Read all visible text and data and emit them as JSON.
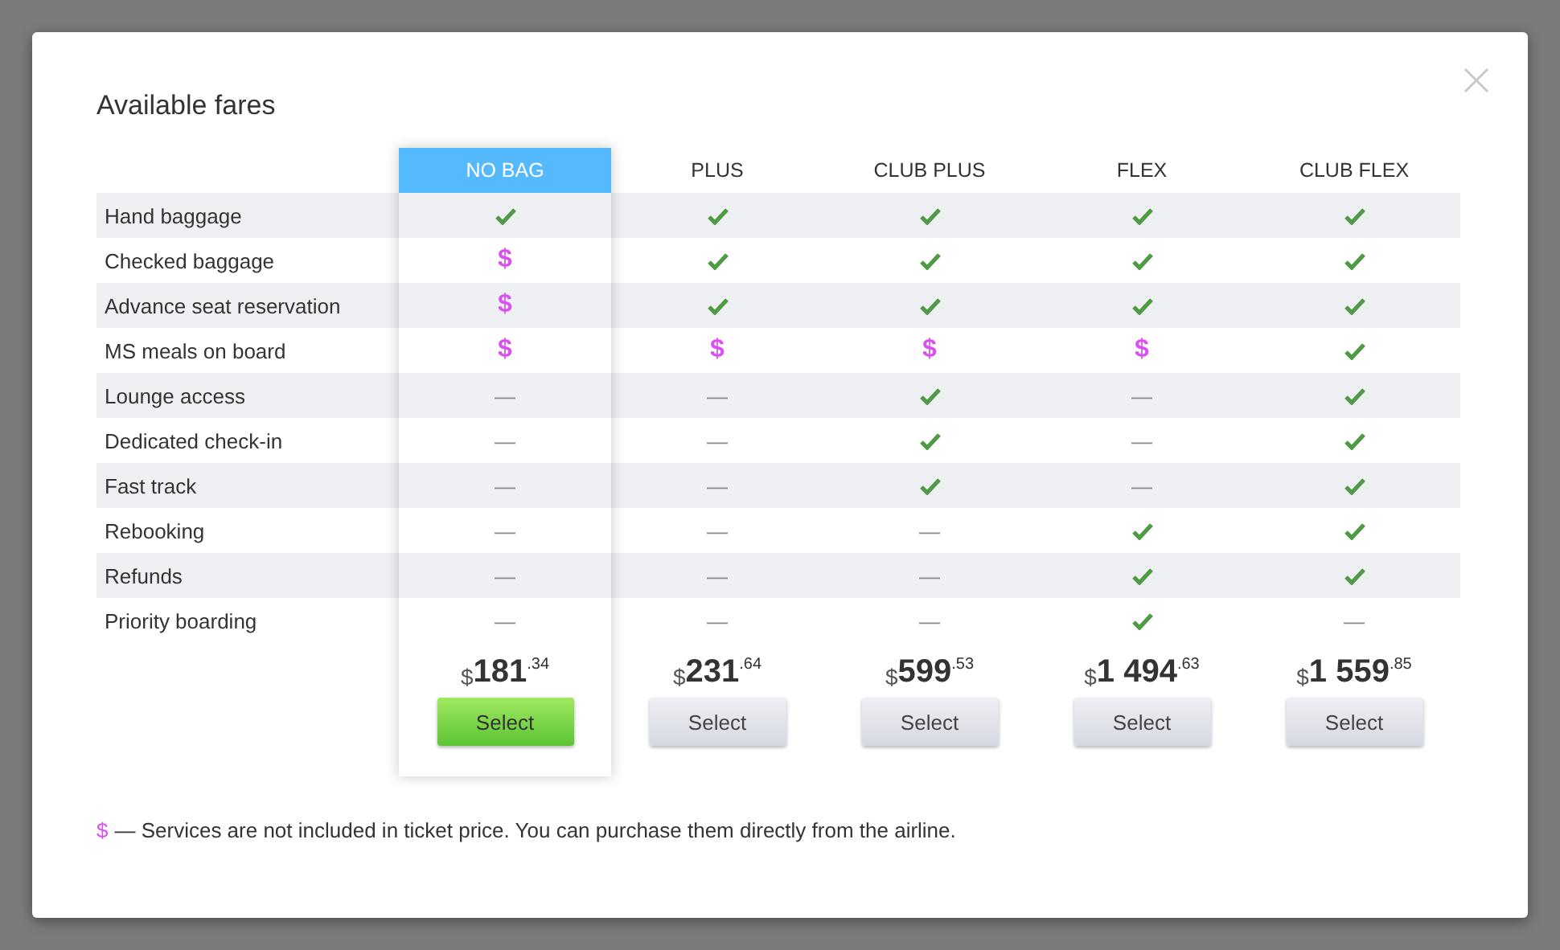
{
  "dialog": {
    "title": "Available fares"
  },
  "features": [
    "Hand baggage",
    "Checked baggage",
    "Advance seat reservation",
    "MS meals on board",
    "Lounge access",
    "Dedicated check-in",
    "Fast track",
    "Rebooking",
    "Refunds",
    "Priority boarding"
  ],
  "fares": [
    {
      "name": "NO BAG",
      "selected": true,
      "currency": "$",
      "amount": "181",
      "cents": ".34",
      "button": "Select",
      "cells": [
        {
          "kind": "check"
        },
        {
          "kind": "paid",
          "text": "$"
        },
        {
          "kind": "paid",
          "text": "$"
        },
        {
          "kind": "paid",
          "text": "$"
        },
        {
          "kind": "none",
          "text": "—"
        },
        {
          "kind": "none",
          "text": "—"
        },
        {
          "kind": "none",
          "text": "—"
        },
        {
          "kind": "none",
          "text": "—"
        },
        {
          "kind": "none",
          "text": "—"
        },
        {
          "kind": "none",
          "text": "—"
        }
      ]
    },
    {
      "name": "PLUS",
      "selected": false,
      "currency": "$",
      "amount": "231",
      "cents": ".64",
      "button": "Select",
      "cells": [
        {
          "kind": "check"
        },
        {
          "kind": "check"
        },
        {
          "kind": "check"
        },
        {
          "kind": "paid",
          "text": "$"
        },
        {
          "kind": "none",
          "text": "—"
        },
        {
          "kind": "none",
          "text": "—"
        },
        {
          "kind": "none",
          "text": "—"
        },
        {
          "kind": "none",
          "text": "—"
        },
        {
          "kind": "none",
          "text": "—"
        },
        {
          "kind": "none",
          "text": "—"
        }
      ]
    },
    {
      "name": "CLUB PLUS",
      "selected": false,
      "currency": "$",
      "amount": "599",
      "cents": ".53",
      "button": "Select",
      "cells": [
        {
          "kind": "check"
        },
        {
          "kind": "check"
        },
        {
          "kind": "check"
        },
        {
          "kind": "paid",
          "text": "$"
        },
        {
          "kind": "check"
        },
        {
          "kind": "check"
        },
        {
          "kind": "check"
        },
        {
          "kind": "none",
          "text": "—"
        },
        {
          "kind": "none",
          "text": "—"
        },
        {
          "kind": "none",
          "text": "—"
        }
      ]
    },
    {
      "name": "FLEX",
      "selected": false,
      "currency": "$",
      "amount": "1 494",
      "cents": ".63",
      "button": "Select",
      "cells": [
        {
          "kind": "check"
        },
        {
          "kind": "check"
        },
        {
          "kind": "check"
        },
        {
          "kind": "paid",
          "text": "$"
        },
        {
          "kind": "none",
          "text": "—"
        },
        {
          "kind": "none",
          "text": "—"
        },
        {
          "kind": "none",
          "text": "—"
        },
        {
          "kind": "check"
        },
        {
          "kind": "check"
        },
        {
          "kind": "check"
        }
      ]
    },
    {
      "name": "CLUB FLEX",
      "selected": false,
      "currency": "$",
      "amount": "1 559",
      "cents": ".85",
      "button": "Select",
      "cells": [
        {
          "kind": "check"
        },
        {
          "kind": "check"
        },
        {
          "kind": "check"
        },
        {
          "kind": "check"
        },
        {
          "kind": "check"
        },
        {
          "kind": "check"
        },
        {
          "kind": "check"
        },
        {
          "kind": "check"
        },
        {
          "kind": "check"
        },
        {
          "kind": "none",
          "text": "—"
        }
      ]
    }
  ],
  "footnote": {
    "mark": "$",
    "text": "— Services are not included in ticket price. You can purchase them directly from the airline."
  }
}
